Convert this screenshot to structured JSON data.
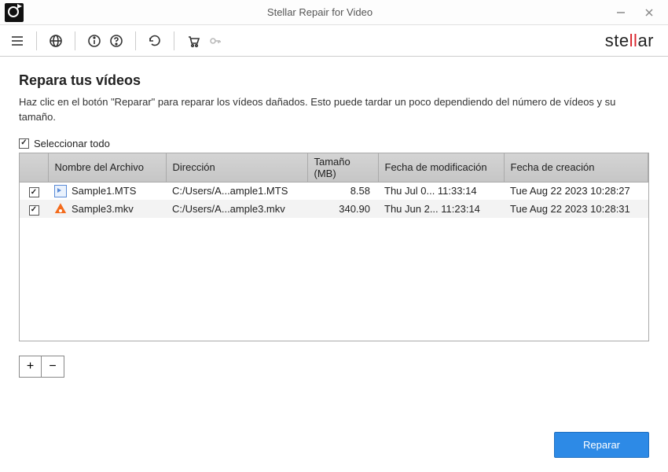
{
  "window": {
    "title": "Stellar Repair for Video"
  },
  "brand": {
    "prefix": "ste",
    "highlight": "ll",
    "suffix": "ar"
  },
  "page": {
    "heading": "Repara tus vídeos",
    "subtitle": "Haz clic en el botón \"Reparar\" para reparar los vídeos dañados. Esto puede tardar un poco dependiendo del número de vídeos y su tamaño."
  },
  "selectAll": {
    "label": "Seleccionar todo",
    "checked": true
  },
  "table": {
    "headers": {
      "filename": "Nombre del Archivo",
      "path": "Dirección",
      "size": "Tamaño (MB)",
      "modified": "Fecha de modificación",
      "created": "Fecha de creación"
    },
    "rows": [
      {
        "checked": true,
        "iconType": "mts",
        "name": "Sample1.MTS",
        "path": "C:/Users/A...ample1.MTS",
        "size": "8.58",
        "modified": "Thu Jul 0... 11:33:14",
        "created": "Tue Aug 22 2023 10:28:27"
      },
      {
        "checked": true,
        "iconType": "mkv",
        "name": "Sample3.mkv",
        "path": "C:/Users/A...ample3.mkv",
        "size": "340.90",
        "modified": "Thu Jun 2... 11:23:14",
        "created": "Tue Aug 22 2023 10:28:31"
      }
    ]
  },
  "actions": {
    "add": "+",
    "remove": "−",
    "repair": "Reparar"
  }
}
